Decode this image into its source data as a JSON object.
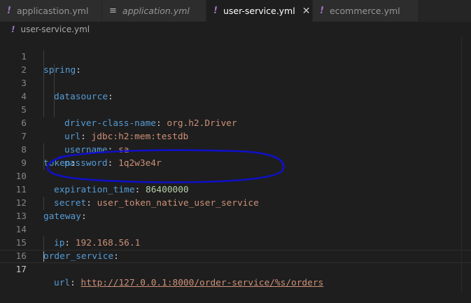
{
  "tabs": [
    {
      "label": "applicastion.yml",
      "icon": "yaml-icon",
      "active": false,
      "italic": false
    },
    {
      "label": "application.yml",
      "icon": "lines-icon",
      "active": false,
      "italic": true
    },
    {
      "label": "user-service.yml",
      "icon": "yaml-icon",
      "active": true,
      "italic": false
    },
    {
      "label": "ecommerce.yml",
      "icon": "yaml-icon",
      "active": false,
      "italic": false
    }
  ],
  "tab_icon_glyph": "!",
  "tab_lines_glyph": "≡",
  "close_glyph": "✕",
  "breadcrumb": {
    "file": "user-service.yml"
  },
  "lines": [
    {
      "num": "1",
      "key": "spring",
      "sep": ":",
      "value": ""
    },
    {
      "num": "2",
      "key": "datasource",
      "sep": ":",
      "value": ""
    },
    {
      "num": "3",
      "key": "driver-class-name",
      "sep": ": ",
      "value": "org.h2.Driver"
    },
    {
      "num": "4",
      "key": "url",
      "sep": ": ",
      "value": "jdbc:h2:mem:testdb"
    },
    {
      "num": "5",
      "key": "username",
      "sep": ": ",
      "value": "sa"
    },
    {
      "num": "6",
      "key": "password",
      "sep": ": ",
      "value": "1q2w3e4r"
    },
    {
      "num": "7",
      "key": "",
      "sep": "",
      "value": ""
    },
    {
      "num": "8",
      "key": "token",
      "sep": ":",
      "value": ""
    },
    {
      "num": "9",
      "key": "expiration_time",
      "sep": ": ",
      "value": "86400000"
    },
    {
      "num": "10",
      "key": "secret",
      "sep": ": ",
      "value": "user_token_native_user_service"
    },
    {
      "num": "11",
      "key": "",
      "sep": "",
      "value": ""
    },
    {
      "num": "12",
      "key": "gateway",
      "sep": ":",
      "value": ""
    },
    {
      "num": "13",
      "key": "ip",
      "sep": ": ",
      "value": "192.168.56.1"
    },
    {
      "num": "14",
      "key": "",
      "sep": "",
      "value": ""
    },
    {
      "num": "15",
      "key": "order_service",
      "sep": ":",
      "value": ""
    },
    {
      "num": "16",
      "key": "url",
      "sep": ": ",
      "value": "http://127.0.0.1:8000/order-service/%s/orders"
    },
    {
      "num": "17",
      "key": "",
      "sep": "",
      "value": ""
    }
  ],
  "colors": {
    "key": "#569cd6",
    "string": "#ce9178",
    "number": "#b5cea8",
    "annotation": "#1010c8"
  }
}
